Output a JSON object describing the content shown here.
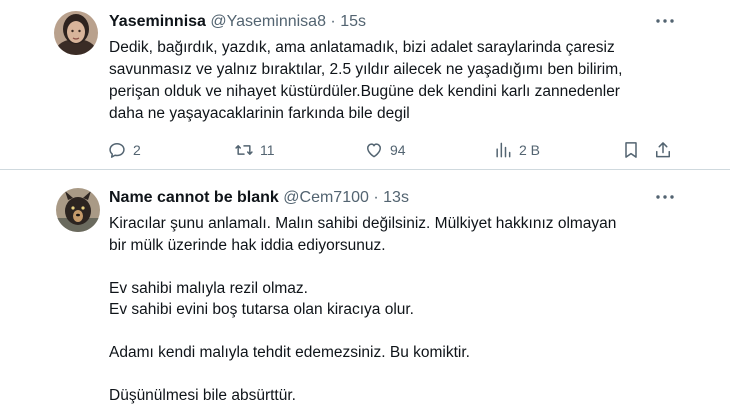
{
  "tweets": [
    {
      "display_name": "Yaseminnisa",
      "handle": "@Yaseminnisa8",
      "separator": "·",
      "time": "15s",
      "text_lines": [
        "Dedik, bağırdık, yazdık,  ama  anlatamadık, bizi adalet  saraylarinda  çaresiz",
        "savunmasız ve yalnız  bıraktılar, 2.5 yıldır ailecek ne yaşadığımı ben bilirim,",
        "perişan olduk ve nihayet küstürdüler.Bugüne dek  kendini karlı zannedenler",
        "daha ne yaşayacaklarinin farkında bile  degil"
      ],
      "replies": "2",
      "retweets": "11",
      "likes": "94",
      "views": "2 B"
    },
    {
      "display_name": "Name cannot be blank",
      "handle": "@Cem7100",
      "separator": "·",
      "time": "13s",
      "text_lines": [
        "Kiracılar şunu anlamalı. Malın sahibi değilsiniz. Mülkiyet hakkınız olmayan",
        "bir mülk üzerinde hak iddia ediyorsunuz.",
        "",
        "Ev sahibi malıyla rezil olmaz.",
        "Ev sahibi evini boş tutarsa olan kiracıya olur.",
        "",
        "Adamı kendi malıyla tehdit edemezsiniz. Bu komiktir.",
        "",
        "Düşünülmesi bile absürttür."
      ]
    }
  ],
  "colors": {
    "text": "#0f1419",
    "secondary": "#536471",
    "divider": "#cfd9de"
  },
  "icons": [
    "more-icon",
    "reply-icon",
    "retweet-icon",
    "like-icon",
    "views-icon",
    "bookmark-icon",
    "share-icon"
  ]
}
